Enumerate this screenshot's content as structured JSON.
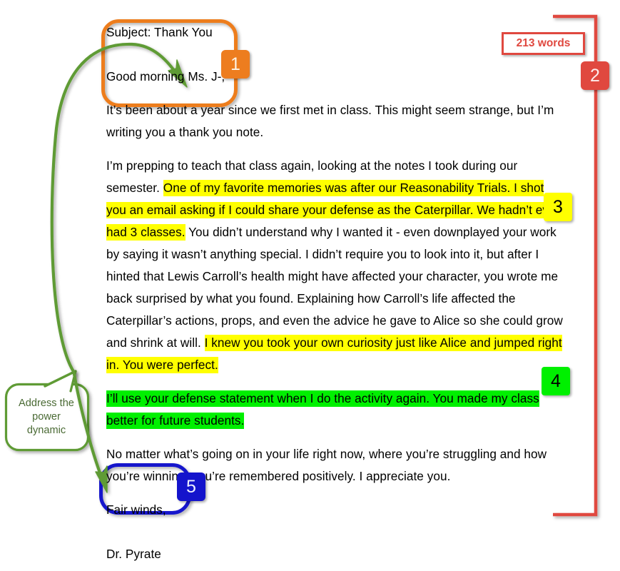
{
  "document": {
    "type": "annotated-email-screenshot",
    "subject_line": "Subject: Thank You",
    "greeting": "Good morning Ms. J-,",
    "paragraphs": {
      "p1": "It’s been about a year since we first met in class. This might seem strange, but I’m writing you a thank you note.",
      "p2_pre": "I’m prepping to teach that class again, looking at the notes I took during our semester. ",
      "p2_highlight_a": "One of my favorite memories was after our Reasonability Trials. I shot you an email asking if I could share your defense as the Caterpillar. We hadn’t even had 3 classes.",
      "p2_mid": " You didn’t understand why I wanted it - even downplayed your work by saying it wasn’t anything special. I didn’t require you to look into it, but after I hinted that Lewis Carroll’s health might have affected your character, you wrote me back surprised by what you found. Explaining how Carroll’s life affected the Caterpillar’s actions, props, and even the advice he gave to Alice so she could grow and shrink at will. ",
      "p2_highlight_b": "I knew you took your own curiosity just like Alice and jumped right in. You were perfect.",
      "p3_highlight": "I’ll use your defense statement when I do the activity again. You made my class better for future students.",
      "p4": "No matter what’s going on in your life right now, where you’re struggling and how you’re winning, you’re remembered positively. I appreciate you."
    },
    "signoff": "Fair winds,",
    "signature": "Dr. Pyrate"
  },
  "annotations": {
    "word_count_chip": {
      "label": "213 words",
      "border_color": "#E0483F",
      "text_color": "#E0483F"
    },
    "comment_bubble": {
      "line1": "Address the",
      "line2": "power",
      "line3": "dynamic",
      "outline_color": "#5F9B34",
      "text_color": "#4A6A34"
    },
    "badges": [
      {
        "number": "1",
        "color": "#ED7D1F",
        "text_color": "#fdf3e4",
        "target": "subject-and-greeting-block"
      },
      {
        "number": "2",
        "color": "#E0483F",
        "text_color": "#fdecec",
        "target": "whole-letter-bracket"
      },
      {
        "number": "3",
        "color": "#ffff00",
        "text_color": "#000000",
        "target": "yellow-highlight-passages"
      },
      {
        "number": "4",
        "color": "#00f000",
        "text_color": "#000000",
        "target": "green-highlight-passage"
      },
      {
        "number": "5",
        "color": "#1414CC",
        "text_color": "#eef0ff",
        "target": "signature-block"
      }
    ],
    "shapes": {
      "orange_rounded_rect": {
        "color": "#ED7D1F",
        "encloses": "subject-and-greeting"
      },
      "blue_rounded_rect": {
        "color": "#1414CC",
        "encloses": "signature-block"
      },
      "red_bracket": {
        "color": "#E0483F",
        "encloses": "entire-letter"
      },
      "green_arrow_long": {
        "color": "#5F9B34",
        "points_to": "greeting"
      },
      "green_arrow_short": {
        "color": "#5F9B34",
        "points_to": "signature-block"
      }
    },
    "highlight_colors": {
      "yellow": "#ffff00",
      "green": "#00f000"
    }
  }
}
